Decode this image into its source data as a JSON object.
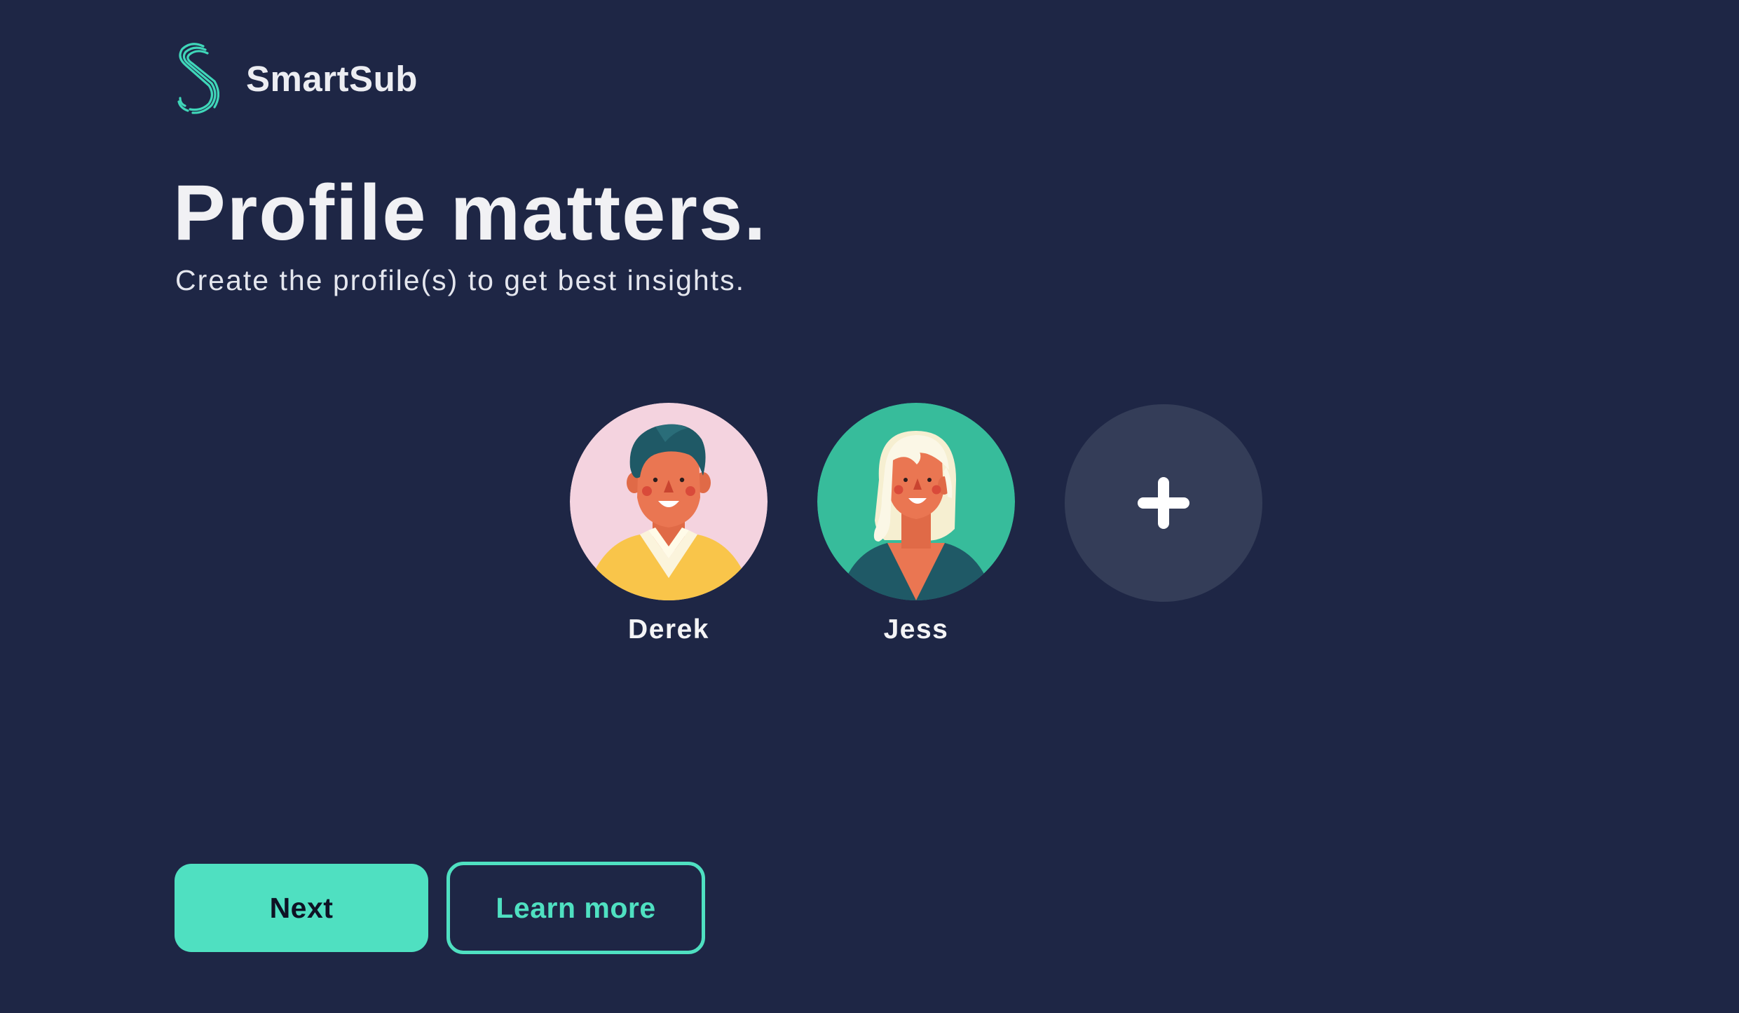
{
  "app": {
    "name": "SmartSub",
    "logo_icon": "smartsub-s-logo-icon",
    "accent_color": "#4fe0c1",
    "background_color": "#1e2645"
  },
  "main": {
    "title": "Profile matters.",
    "subtitle": "Create the profile(s) to get best insights."
  },
  "profiles": [
    {
      "name": "Derek",
      "avatar_icon": "man-avatar-icon",
      "avatar_bg": "#f4d3df"
    },
    {
      "name": "Jess",
      "avatar_icon": "woman-avatar-icon",
      "avatar_bg": "#37bc9b"
    }
  ],
  "add_profile": {
    "icon": "plus-icon"
  },
  "actions": {
    "next_label": "Next",
    "learn_more_label": "Learn more"
  }
}
